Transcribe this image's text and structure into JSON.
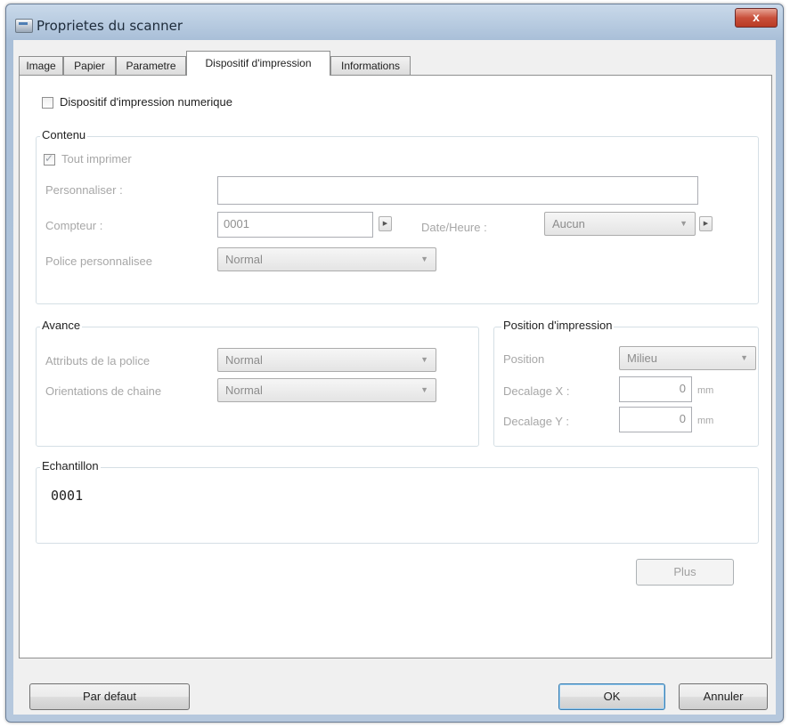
{
  "window": {
    "title": "Proprietes du scanner",
    "close_glyph": "x"
  },
  "tabs": [
    {
      "label": "Image"
    },
    {
      "label": "Papier"
    },
    {
      "label": "Parametre"
    },
    {
      "label": "Dispositif d'impression",
      "active": true
    },
    {
      "label": "Informations"
    }
  ],
  "digital_imprinter": {
    "label": "Dispositif d'impression numerique",
    "checked": false
  },
  "content": {
    "title": "Contenu",
    "print_all": {
      "label": "Tout imprimer",
      "checked": true
    },
    "custom_label": "Personnaliser :",
    "custom_value": "",
    "counter_label": "Compteur :",
    "counter_value": "0001",
    "datetime_label": "Date/Heure :",
    "datetime_value": "Aucun",
    "font_label": "Police personnalisee",
    "font_value": "Normal"
  },
  "advanced": {
    "title": "Avance",
    "font_attr_label": "Attributs de la police",
    "font_attr_value": "Normal",
    "orientation_label": "Orientations de chaine",
    "orientation_value": "Normal"
  },
  "print_position": {
    "title": "Position d'impression",
    "position_label": "Position",
    "position_value": "Milieu",
    "offset_x_label": "Decalage X :",
    "offset_x_value": "0",
    "offset_x_unit": "mm",
    "offset_y_label": "Decalage Y :",
    "offset_y_value": "0",
    "offset_y_unit": "mm"
  },
  "sample": {
    "title": "Echantillon",
    "text": "0001"
  },
  "buttons": {
    "more": "Plus",
    "default": "Par defaut",
    "ok": "OK",
    "cancel": "Annuler"
  },
  "colors": {
    "title_bar": "#b6c8dd",
    "close_button": "#c9503b",
    "default_button_border": "#3c7fb1"
  },
  "icons": {
    "window": "scanner-icon",
    "dropdown": "chevron-down-icon",
    "spin": "arrow-right-icon"
  }
}
